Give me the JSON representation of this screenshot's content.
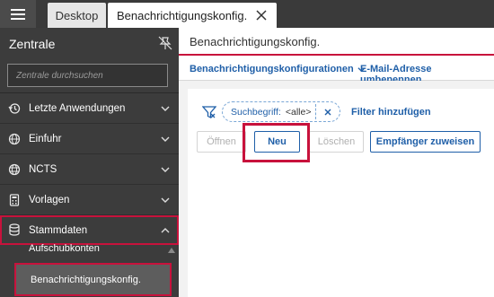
{
  "tabs": {
    "desktop_label": "Desktop",
    "active_label": "Benachrichtigungskonfig."
  },
  "sidebar": {
    "title": "Zentrale",
    "search_placeholder": "Zentrale durchsuchen",
    "items": [
      {
        "label": "Letzte Anwendungen",
        "icon": "history-icon"
      },
      {
        "label": "Einfuhr",
        "icon": "globe-import-icon"
      },
      {
        "label": "NCTS",
        "icon": "globe-ncts-icon"
      },
      {
        "label": "Vorlagen",
        "icon": "calculator-icon"
      },
      {
        "label": "Stammdaten",
        "icon": "database-icon",
        "expanded": true
      }
    ],
    "sub_items": [
      {
        "label": "Aufschubkonten"
      },
      {
        "label": "Benachrichtigungskonfig.",
        "selected": true
      }
    ]
  },
  "main": {
    "title": "Benachrichtigungskonfig.",
    "toolbar": {
      "config_menu": "Benachrichtigungskonfigurationen",
      "rename_email": "E-Mail-Adresse umbenennen"
    },
    "filter": {
      "chip_label": "Suchbegriff:",
      "chip_value": "<alle>",
      "add_filter": "Filter hinzufügen"
    },
    "buttons": {
      "open": "Öffnen",
      "new": "Neu",
      "delete": "Löschen",
      "assign_recipient": "Empfänger zuweisen"
    }
  },
  "colors": {
    "accent_red": "#c8123c",
    "link_blue": "#1f5fa8",
    "sidebar_bg": "#3c3c3c"
  }
}
